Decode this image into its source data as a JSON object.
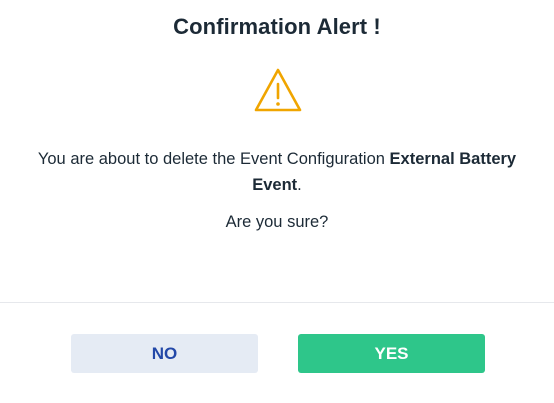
{
  "dialog": {
    "title": "Confirmation Alert !",
    "icon": "warning-triangle-icon",
    "message_prefix": "You are about to delete the Event Configuration ",
    "message_bold": "External Battery Event",
    "message_suffix": ".",
    "question": "Are you sure?",
    "no_label": "NO",
    "yes_label": "YES"
  },
  "colors": {
    "warning": "#f0a500",
    "yes_button": "#2ec68a",
    "no_button_bg": "#e5ebf4",
    "no_button_text": "#2348a8",
    "text": "#1c2a36"
  }
}
